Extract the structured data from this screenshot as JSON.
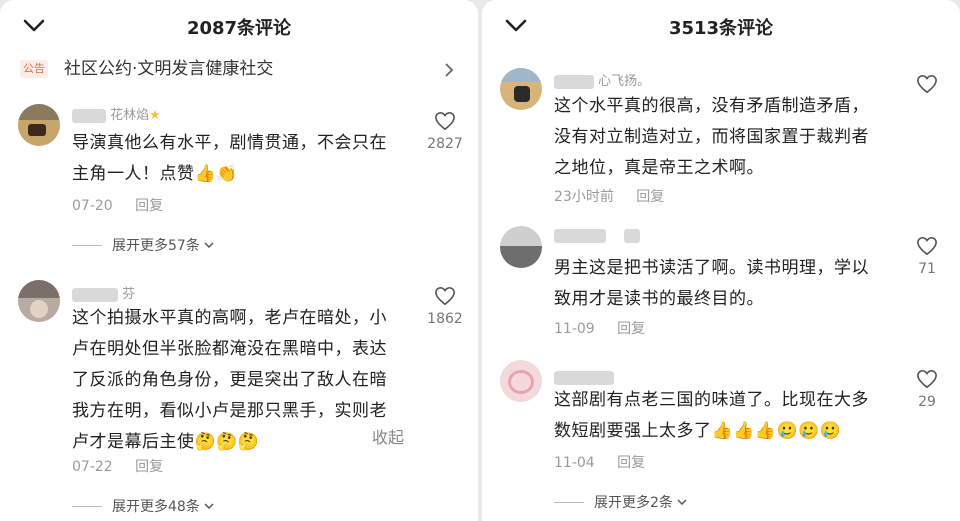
{
  "left": {
    "title": "2087条评论",
    "notice": {
      "badge": "公告",
      "text": "社区公约·文明发言健康社交"
    },
    "comments": [
      {
        "username": "花林焰",
        "text_line1": "导演真他么有水平，剧情贯通，不会只在",
        "text_line2": "主角一人！点赞👍👏",
        "date": "07-20",
        "reply": "回复",
        "likes": "2827",
        "expand": "展开更多57条"
      },
      {
        "username": "芬",
        "text_line1": "这个拍摄水平真的高啊，老卢在暗处，小",
        "text_line2": "卢在明处但半张脸都淹没在黑暗中，表达",
        "text_line3": "了反派的角色身份，更是突出了敌人在暗",
        "text_line4": "我方在明，看似小卢是那只黑手，实则老",
        "text_line5": "卢才是幕后主使🤔🤔🤔",
        "collapse": "收起",
        "date": "07-22",
        "reply": "回复",
        "likes": "1862",
        "expand": "展开更多48条"
      }
    ]
  },
  "right": {
    "title": "3513条评论",
    "comments": [
      {
        "username": "心飞扬。",
        "text_line1": "这个水平真的很高，没有矛盾制造矛盾，",
        "text_line2": "没有对立制造对立，而将国家置于裁判者",
        "text_line3": "之地位，真是帝王之术啊。",
        "date": "23小时前",
        "reply": "回复"
      },
      {
        "username": "",
        "text_line1": "男主这是把书读活了啊。读书明理，学以",
        "text_line2": "致用才是读书的最终目的。",
        "date": "11-09",
        "reply": "回复",
        "likes": "71"
      },
      {
        "username": "",
        "text_line1": "这部剧有点老三国的味道了。比现在大多",
        "text_line2": "数短剧要强上太多了👍👍👍🥲🥲🥲",
        "date": "11-04",
        "reply": "回复",
        "likes": "29",
        "expand": "展开更多2条"
      }
    ]
  },
  "icons": {
    "heart": "heart-icon",
    "collapse_chevron": "chevron-down-icon",
    "notice_arrow": "chevron-right-icon"
  },
  "colors": {
    "notice_badge_text": "#e0703a",
    "notice_badge_bg": "#fbeee8",
    "meta": "#9b9b9b"
  }
}
